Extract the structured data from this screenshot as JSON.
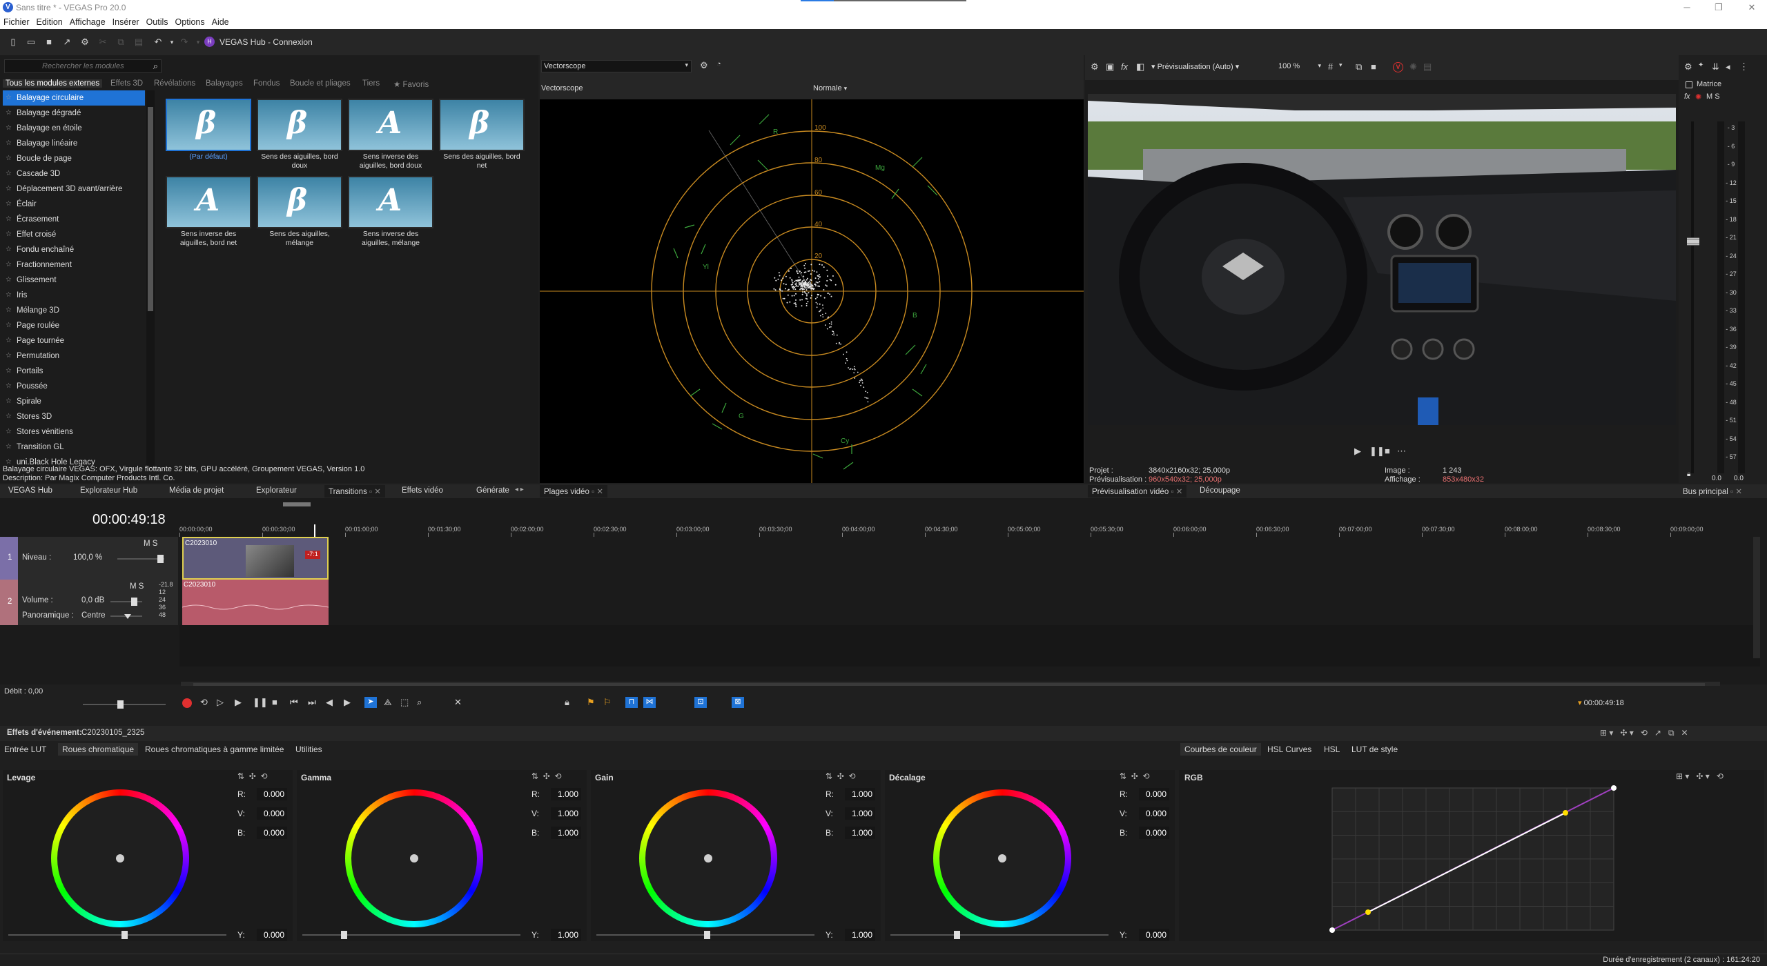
{
  "title_bar": {
    "title": "Sans titre * - VEGAS Pro 20.0",
    "logo": "V"
  },
  "menu": [
    "Fichier",
    "Edition",
    "Affichage",
    "Insérer",
    "Outils",
    "Options",
    "Aide"
  ],
  "toolbar": {
    "hub": "VEGAS Hub - Connexion"
  },
  "transitions": {
    "search_placeholder": "Rechercher les modules",
    "tabs": [
      "Tous les modules externes",
      "Effets 3D",
      "Révélations",
      "Balayages",
      "Fondus",
      "Boucle et pliages",
      "Tiers",
      "★ Favoris"
    ],
    "items": [
      "Balayage circulaire",
      "Balayage dégradé",
      "Balayage en étoile",
      "Balayage linéaire",
      "Boucle de page",
      "Cascade 3D",
      "Déplacement 3D avant/arrière",
      "Éclair",
      "Écrasement",
      "Effet croisé",
      "Fondu enchaîné",
      "Fractionnement",
      "Glissement",
      "Iris",
      "Mélange 3D",
      "Page roulée",
      "Page tournée",
      "Permutation",
      "Portails",
      "Poussée",
      "Spirale",
      "Stores 3D",
      "Stores vénitiens",
      "Transition GL",
      "uni.Black Hole Legacy"
    ],
    "presets": [
      {
        "label": "(Par défaut)",
        "glyph": "β"
      },
      {
        "label": "Sens des aiguilles, bord doux",
        "glyph": "β"
      },
      {
        "label": "Sens inverse des aiguilles, bord doux",
        "glyph": "A"
      },
      {
        "label": "Sens des aiguilles, bord net",
        "glyph": "β"
      },
      {
        "label": "Sens inverse des aiguilles, bord net",
        "glyph": "A"
      },
      {
        "label": "Sens des aiguilles, mélange",
        "glyph": "β"
      },
      {
        "label": "Sens inverse des aiguilles, mélange",
        "glyph": "A"
      }
    ],
    "status1": "Balayage circulaire VEGAS: OFX, Virgule flottante 32 bits, GPU accéléré, Groupement VEGAS, Version 1.0",
    "status2": "Description: Par Magix Computer Products Intl. Co."
  },
  "dock_tabs_left": [
    "VEGAS Hub",
    "Explorateur Hub",
    "Média de projet",
    "Explorateur",
    "Transitions",
    "Effets vidéo",
    "Générate"
  ],
  "dock_tab_mid": "Plages vidéo",
  "dock_tabs_right": [
    "Prévisualisation vidéo",
    "Découpage"
  ],
  "dock_tab_bus": "Bus principal",
  "vectorscope": {
    "dropdown": "Vectorscope",
    "title": "Vectorscope",
    "mode": "Normale",
    "ring_labels": [
      "100",
      "80",
      "60",
      "40",
      "20"
    ],
    "targets": [
      "R",
      "Mg",
      "B",
      "Cy",
      "G",
      "Yl"
    ]
  },
  "preview": {
    "mode": "Prévisualisation (Auto)",
    "zoom": "100 %",
    "projet_label": "Projet :",
    "projet_val": "3840x2160x32; 25,000p",
    "prev_label": "Prévisualisation :",
    "prev_val": "960x540x32; 25,000p",
    "image_label": "Image :",
    "image_val": "1 243",
    "aff_label": "Affichage :",
    "aff_val": "853x480x32"
  },
  "master": {
    "label": "Matrice",
    "ms": "M   S",
    "scale": [
      "3",
      "6",
      "9",
      "12",
      "15",
      "18",
      "21",
      "24",
      "27",
      "30",
      "33",
      "36",
      "39",
      "42",
      "45",
      "48",
      "51",
      "54",
      "57"
    ],
    "scale_sign": "-",
    "bottom": [
      "0.0",
      "0.0"
    ]
  },
  "timeline": {
    "timecode": "00:00:49:18",
    "ruler": [
      "00:00:00;00",
      "00:00:30;00",
      "00:01:00;00",
      "00:01:30;00",
      "00:02:00;00",
      "00:02:30;00",
      "00:03:00;00",
      "00:03:30;00",
      "00:04:00;00",
      "00:04:30;00",
      "00:05:00;00",
      "00:05:30;00",
      "00:06:00;00",
      "00:06:30;00",
      "00:07:00;00",
      "00:07:30;00",
      "00:08:00;00",
      "00:08:30;00",
      "00:09:00;00"
    ],
    "video_track": {
      "num": "1",
      "niveau_label": "Niveau :",
      "niveau_val": "100,0 %",
      "ms": "M  S"
    },
    "audio_track": {
      "num": "2",
      "volume_label": "Volume :",
      "volume_val": "0,0 dB",
      "pan_label": "Panoramique :",
      "pan_val": "Centre",
      "ms": "M  S",
      "meter": [
        "-21.8",
        "12",
        "24",
        "36",
        "48"
      ]
    },
    "clip_label": "C2023010",
    "rate": "Débit : 0,00",
    "transport_timecode": "00:00:49:18"
  },
  "fx": {
    "header_label": "Effets d'événement:",
    "header_clip": "C20230105_2325",
    "tabs": [
      "Entrée LUT",
      "Roues chromatique",
      "Roues chromatiques à gamme limitée",
      "Utilities"
    ],
    "tabs_right": [
      "Courbes de couleur",
      "HSL Curves",
      "HSL",
      "LUT de style"
    ],
    "wheels": [
      {
        "name": "Levage",
        "r": "0.000",
        "v": "0.000",
        "b": "0.000",
        "y": "0.000"
      },
      {
        "name": "Gamma",
        "r": "1.000",
        "v": "1.000",
        "b": "1.000",
        "y": "1.000"
      },
      {
        "name": "Gain",
        "r": "1.000",
        "v": "1.000",
        "b": "1.000",
        "y": "1.000"
      },
      {
        "name": "Décalage",
        "r": "0.000",
        "v": "0.000",
        "b": "0.000",
        "y": "0.000"
      }
    ],
    "channel_labels": {
      "r": "R:",
      "v": "V:",
      "b": "B:",
      "y": "Y:"
    },
    "curve_channel": "RGB"
  },
  "status_bar": "Durée d'enregistrement (2 canaux) : 161:24:20"
}
